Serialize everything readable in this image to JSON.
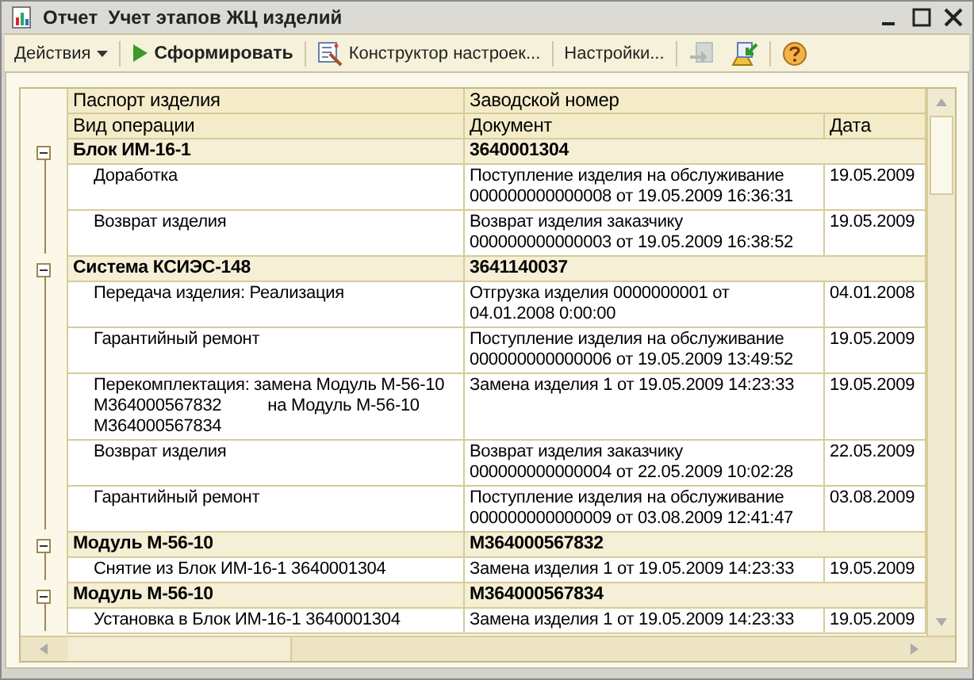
{
  "window": {
    "title": "Отчет  Учет этапов ЖЦ изделий"
  },
  "toolbar": {
    "items": [
      {
        "kind": "menu",
        "label": "Действия"
      },
      {
        "kind": "run",
        "label": "Сформировать"
      },
      {
        "kind": "designer",
        "label": "Конструктор настроек..."
      },
      {
        "kind": "text",
        "label": "Настройки..."
      },
      {
        "kind": "load",
        "disabled": true
      },
      {
        "kind": "save",
        "disabled": false
      },
      {
        "kind": "help"
      }
    ]
  },
  "table": {
    "header_top": [
      "Паспорт изделия",
      "Заводской номер"
    ],
    "header_bottom": [
      "Вид операции",
      "Документ",
      "Дата"
    ],
    "groups": [
      {
        "name": "Блок ИМ-16-1",
        "serial": "3640001304",
        "expanded": true,
        "rows": [
          {
            "operation": "Доработка",
            "document": "Поступление изделия на обслуживание 000000000000008 от 19.05.2009 16:36:31",
            "date": "19.05.2009"
          },
          {
            "operation": "Возврат изделия",
            "document": "Возврат изделия заказчику 000000000000003 от 19.05.2009 16:38:52",
            "date": "19.05.2009"
          }
        ]
      },
      {
        "name": "Система КСИЭС-148",
        "serial": "3641140037",
        "expanded": true,
        "rows": [
          {
            "operation": "Передача изделия: Реализация",
            "document": "Отгрузка изделия 0000000001 от 04.01.2008 0:00:00",
            "date": "04.01.2008"
          },
          {
            "operation": "Гарантийный ремонт",
            "document": "Поступление изделия на обслуживание 000000000000006 от 19.05.2009 13:49:52",
            "date": "19.05.2009"
          },
          {
            "operation": "Перекомплектация: замена Модуль М-56-10 М364000567832          на Модуль М-56-10 М364000567834",
            "document": "Замена изделия 1 от 19.05.2009 14:23:33",
            "date": "19.05.2009"
          },
          {
            "operation": "Возврат изделия",
            "document": "Возврат изделия заказчику 000000000000004 от 22.05.2009 10:02:28",
            "date": "22.05.2009"
          },
          {
            "operation": "Гарантийный ремонт",
            "document": "Поступление изделия на обслуживание 000000000000009 от 03.08.2009 12:41:47",
            "date": "03.08.2009"
          }
        ]
      },
      {
        "name": "Модуль М-56-10",
        "serial": "М364000567832",
        "expanded": true,
        "rows": [
          {
            "operation": "Снятие из Блок ИМ-16-1 3640001304",
            "document": "Замена изделия 1 от 19.05.2009 14:23:33",
            "date": "19.05.2009"
          }
        ]
      },
      {
        "name": "Модуль М-56-10",
        "serial": "М364000567834",
        "expanded": true,
        "rows": [
          {
            "operation": "Установка в Блок ИМ-16-1 3640001304",
            "document": "Замена изделия 1 от 19.05.2009 14:23:33",
            "date": "19.05.2009"
          }
        ]
      }
    ]
  }
}
